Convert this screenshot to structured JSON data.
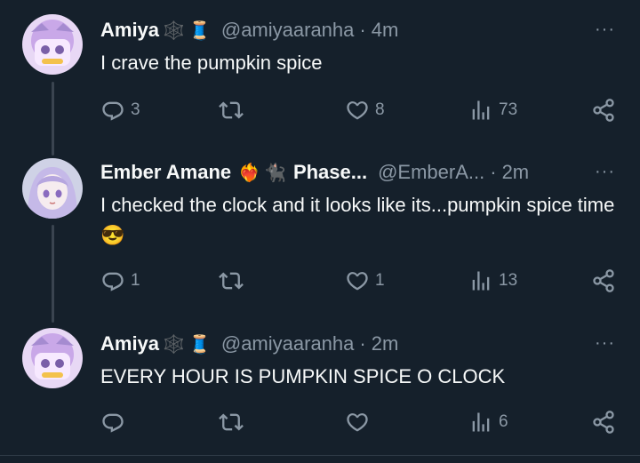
{
  "colors": {
    "background": "#15202b",
    "text": "#f7f9f9",
    "muted": "#8b98a5",
    "divider": "#2f3b47"
  },
  "tweets": [
    {
      "name": "Amiya",
      "badges": [
        "🕸️",
        "🧵"
      ],
      "handle": "@amiyaaranha",
      "separator": "·",
      "time": "4m",
      "text": "I crave the pumpkin spice",
      "more": "···",
      "replies": "3",
      "retweets": "",
      "likes": "8",
      "views": "73"
    },
    {
      "name": "Ember Amane",
      "badges": [
        "❤️‍🔥",
        "🐈‍⬛"
      ],
      "name_suffix": "Phase...",
      "handle": "@EmberA...",
      "separator": "·",
      "time": "2m",
      "text": "I checked the clock and it looks like its...pumpkin spice time",
      "text_emoji": "😎",
      "more": "···",
      "replies": "1",
      "retweets": "",
      "likes": "1",
      "views": "13"
    },
    {
      "name": "Amiya",
      "badges": [
        "🕸️",
        "🧵"
      ],
      "handle": "@amiyaaranha",
      "separator": "·",
      "time": "2m",
      "text": "EVERY HOUR IS PUMPKIN SPICE O CLOCK",
      "more": "···",
      "replies": "",
      "retweets": "",
      "likes": "",
      "views": "6"
    }
  ]
}
